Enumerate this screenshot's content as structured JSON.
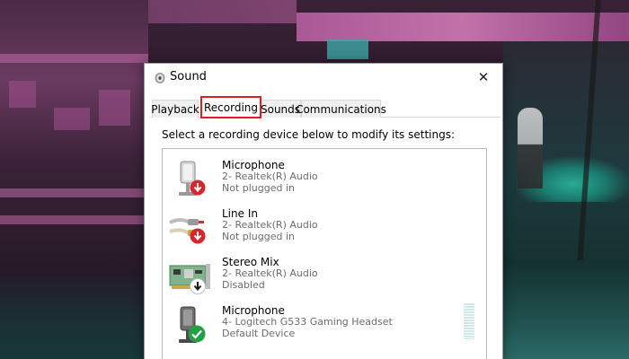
{
  "dialog": {
    "title": "Sound",
    "close_glyph": "✕",
    "icon": "speaker-icon"
  },
  "tabs": [
    {
      "label": "Playback",
      "active": false
    },
    {
      "label": "Recording",
      "active": true
    },
    {
      "label": "Sounds",
      "active": false
    },
    {
      "label": "Communications",
      "active": false
    }
  ],
  "instructions": "Select a recording device below to modify its settings:",
  "devices": [
    {
      "name": "Microphone",
      "sub": "2- Realtek(R) Audio",
      "status": "Not plugged in",
      "icon": "microphone-icon",
      "badge": "red-down-arrow-icon"
    },
    {
      "name": "Line In",
      "sub": "2- Realtek(R) Audio",
      "status": "Not plugged in",
      "icon": "line-in-cable-icon",
      "badge": "red-down-arrow-icon"
    },
    {
      "name": "Stereo Mix",
      "sub": "2- Realtek(R) Audio",
      "status": "Disabled",
      "icon": "sound-card-icon",
      "badge": "black-down-arrow-icon"
    },
    {
      "name": "Microphone",
      "sub": "4- Logitech G533 Gaming Headset",
      "status": "Default Device",
      "icon": "headset-microphone-icon",
      "badge": "green-check-icon"
    }
  ],
  "colors": {
    "highlight": "#e01e22",
    "badge_red": "#d9262c",
    "badge_green": "#23a047",
    "badge_black": "#1c1c1c"
  }
}
